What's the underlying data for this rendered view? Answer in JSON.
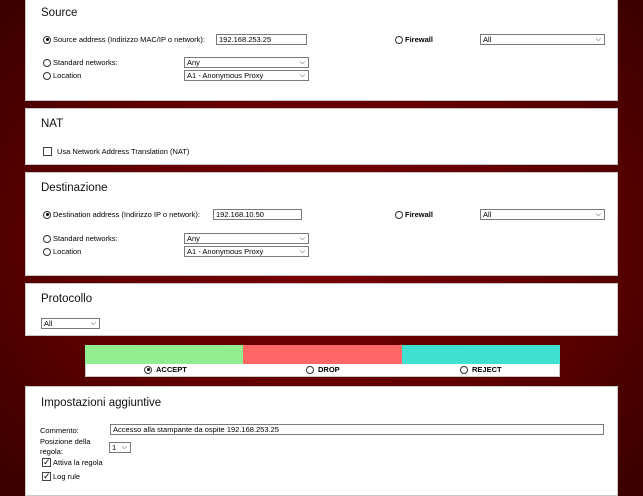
{
  "source": {
    "title": "Source",
    "address_label": "Source address (Indirizzo MAC/IP o network):",
    "address_value": "192.168.253.25",
    "firewall_label": "Firewall",
    "firewall_select": "All",
    "standard_label": "Standard networks:",
    "standard_select": "Any",
    "location_label": "Location",
    "location_select": "A1 - Anonymous Proxy"
  },
  "nat": {
    "title": "NAT",
    "checkbox_label": "Usa Network Address Translation (NAT)",
    "checked": false
  },
  "destination": {
    "title": "Destinazione",
    "address_label": "Destination address (Indirizzo IP o network):",
    "address_value": "192.168.10.50",
    "firewall_label": "Firewall",
    "firewall_select": "All",
    "standard_label": "Standard networks:",
    "standard_select": "Any",
    "location_label": "Location",
    "location_select": "A1 - Anonymous Proxy"
  },
  "protocol": {
    "title": "Protocollo",
    "select": "All"
  },
  "actions": {
    "accept": {
      "label": "ACCEPT",
      "color": "#90ee90",
      "selected": true
    },
    "drop": {
      "label": "DROP",
      "color": "#ff6666",
      "selected": false
    },
    "reject": {
      "label": "REJECT",
      "color": "#40e0d0",
      "selected": false
    }
  },
  "additional": {
    "title": "Impostazioni aggiuntive",
    "comment_label": "Commento:",
    "comment_value": "Accesso alla stampante da ospite 192.168.253.25",
    "position_label_1": "Posizione della",
    "position_label_2": "regola:",
    "position_value": "1",
    "enable_label": "Attiva la regola",
    "log_label": "Log rule",
    "enable_checked": true,
    "log_checked": true
  }
}
